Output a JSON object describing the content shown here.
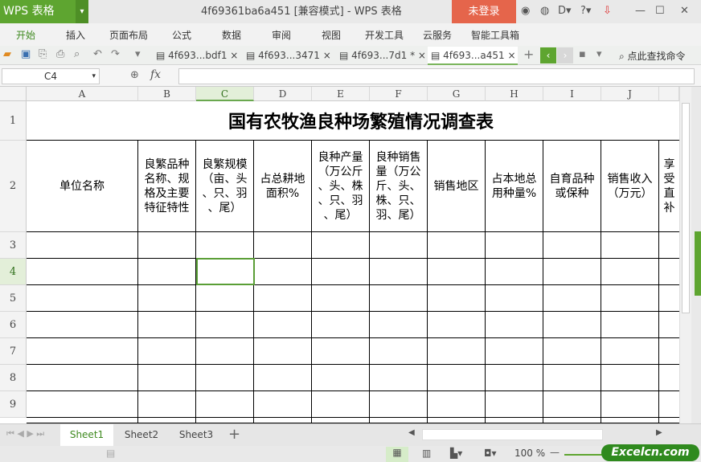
{
  "app": {
    "logo": "WPS 表格",
    "window_title": "4f69361ba6a451 [兼容模式] - WPS 表格",
    "login": "未登录"
  },
  "menu": [
    "开始",
    "插入",
    "页面布局",
    "公式",
    "数据",
    "审阅",
    "视图",
    "开发工具",
    "云服务",
    "智能工具箱"
  ],
  "doc_tabs": [
    {
      "label": "4f693...bdf1"
    },
    {
      "label": "4f693...3471"
    },
    {
      "label": "4f693...7d1 *"
    },
    {
      "label": "4f693...a451"
    }
  ],
  "search_command": "点此查找命令",
  "formula": {
    "name_box": "C4",
    "fx": "fx",
    "value": ""
  },
  "columns": [
    "A",
    "B",
    "C",
    "D",
    "E",
    "F",
    "G",
    "H",
    "I",
    "J"
  ],
  "rows": [
    "1",
    "2",
    "3",
    "4",
    "5",
    "6",
    "7",
    "8",
    "9"
  ],
  "sheet": {
    "title": "国有农牧渔良种场繁殖情况调查表",
    "headers": [
      "单位名称",
      "良繁品种\n名称、规\n格及主要\n特征特性",
      "良繁规模\n（亩、头\n、只、羽\n、尾）",
      "占总耕地\n面积%",
      "良种产量\n（万公斤\n、头、株\n、只、羽\n、尾）",
      "良种销售\n量（万公\n斤、头、\n株、只、\n羽、尾）",
      "销售地区",
      "占本地总\n用种量%",
      "自育品种\n或保种",
      "销售收入\n（万元）",
      "享受\n直补"
    ]
  },
  "sheet_tabs": [
    "Sheet1",
    "Sheet2",
    "Sheet3"
  ],
  "status": {
    "zoom": "100 %",
    "brand": "Excelcn.com"
  },
  "colors": {
    "accent": "#5ea530",
    "login": "#e5654b"
  }
}
